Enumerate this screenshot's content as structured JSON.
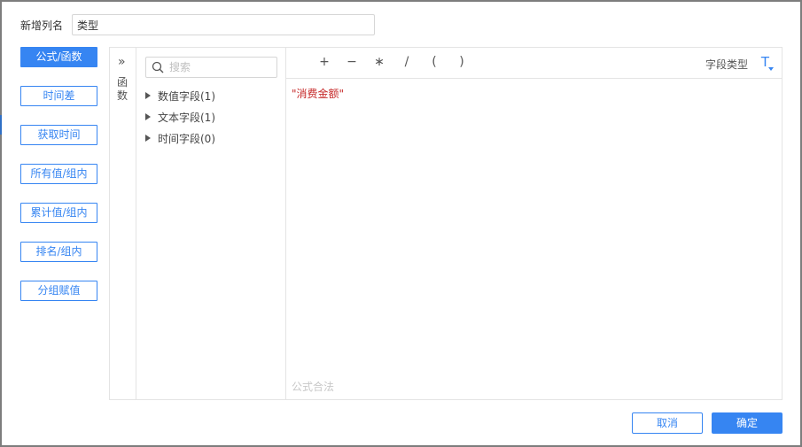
{
  "dialog": {
    "name_label": "新增列名",
    "name_value": "类型"
  },
  "left_buttons": [
    {
      "label": "公式/函数",
      "active": true
    },
    {
      "label": "时间差",
      "active": false
    },
    {
      "label": "获取时间",
      "active": false
    },
    {
      "label": "所有值/组内",
      "active": false
    },
    {
      "label": "累计值/组内",
      "active": false
    },
    {
      "label": "排名/组内",
      "active": false
    },
    {
      "label": "分组赋值",
      "active": false
    }
  ],
  "function_panel": {
    "toggle": "»",
    "label": "函数"
  },
  "field_panel": {
    "search_placeholder": "搜索",
    "groups": [
      {
        "label": "数值字段(1)"
      },
      {
        "label": "文本字段(1)"
      },
      {
        "label": "时间字段(0)"
      }
    ]
  },
  "editor": {
    "operators": [
      "+",
      "−",
      "∗",
      "/",
      "(",
      ")"
    ],
    "field_type_label": "字段类型",
    "field_type_icon": "T",
    "formula": "\"消费金额\"",
    "status": "公式合法"
  },
  "footer": {
    "cancel_label": "取消",
    "ok_label": "确定"
  },
  "colors": {
    "accent": "#3685f2",
    "formula_field": "#c62828"
  }
}
